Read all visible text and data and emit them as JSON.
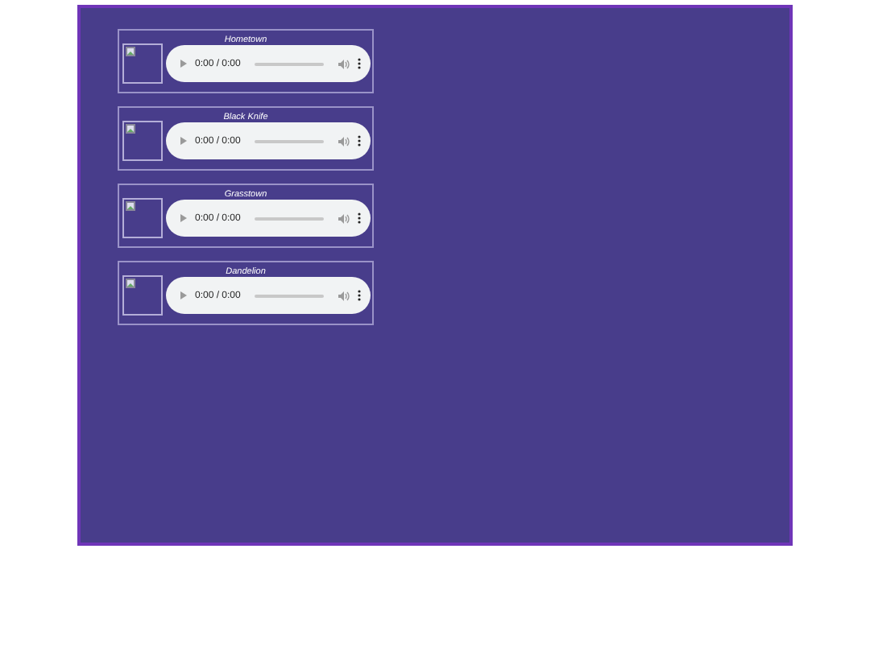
{
  "tracks": [
    {
      "title": "Hometown",
      "time": "0:00 / 0:00"
    },
    {
      "title": "Black Knife",
      "time": "0:00 / 0:00"
    },
    {
      "title": "Grasstown",
      "time": "0:00 / 0:00"
    },
    {
      "title": "Dandelion",
      "time": "0:00 / 0:00"
    }
  ]
}
